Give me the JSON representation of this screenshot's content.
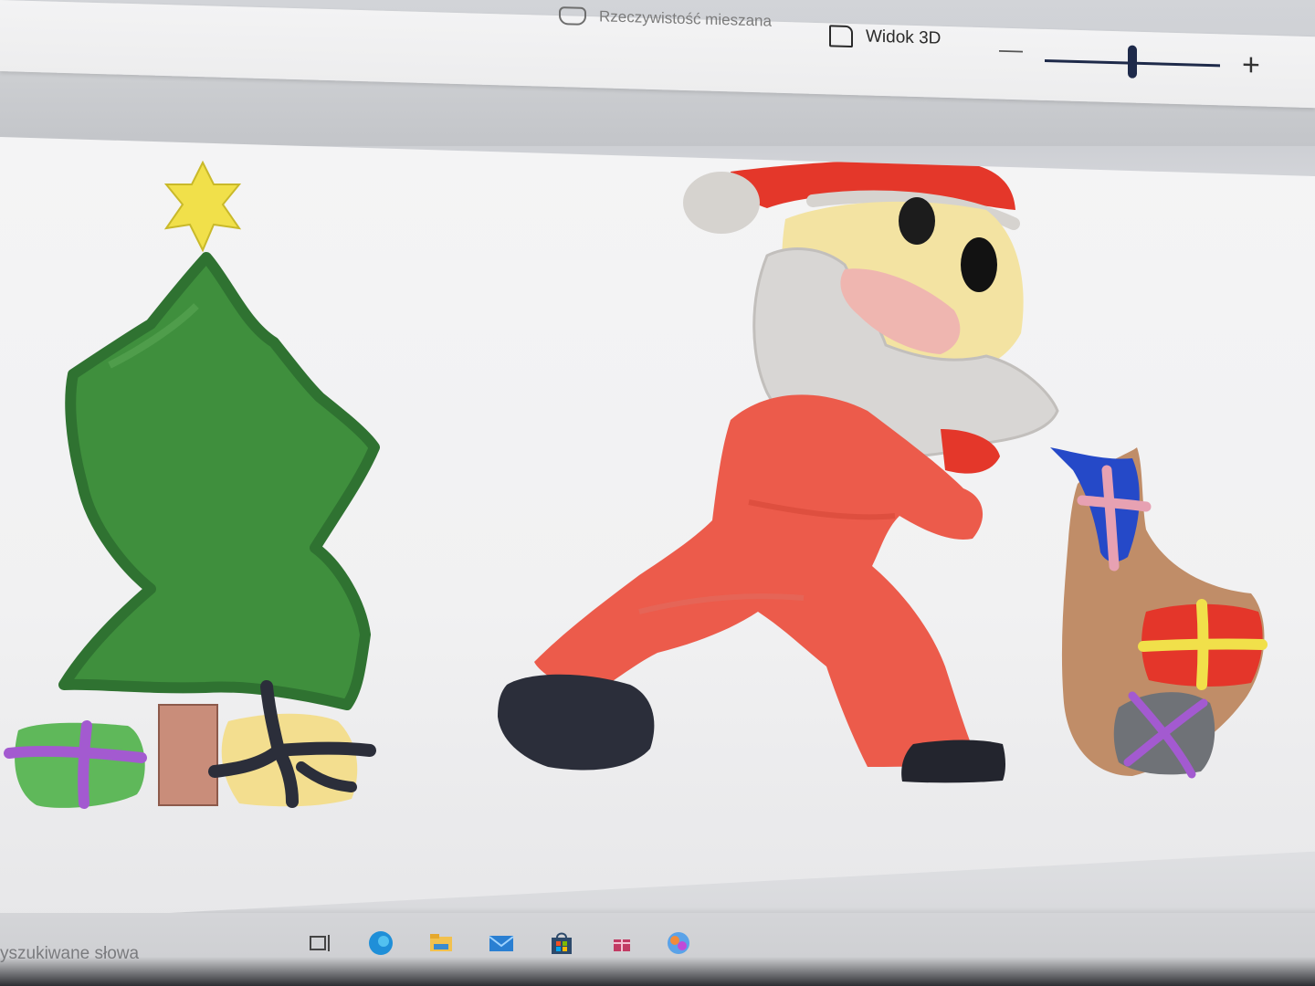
{
  "toolbar": {
    "mixed_reality_label": "Rzeczywistość mieszana",
    "view3d_label": "Widok 3D",
    "zoom_minus": "—",
    "zoom_plus": "+"
  },
  "zoom": {
    "level": 0.5
  },
  "taskbar": {
    "search_placeholder": "yszukiwane słowa",
    "icons": [
      "task-view-icon",
      "edge-icon",
      "file-explorer-icon",
      "mail-icon",
      "store-icon",
      "gift-icon",
      "paint3d-icon"
    ]
  },
  "colors": {
    "tree_green": "#3f8f3d",
    "santa_red": "#ec5b4b",
    "beard_gray": "#d8d6d4",
    "face_yellow": "#f3e3a2",
    "boot_black": "#2b2e3a",
    "sack_brown": "#c08d68",
    "star_yellow": "#f1e04a",
    "ribbon_purple": "#a35ad0",
    "ribbon_blue": "#2549c8",
    "ribbon_pink": "#e7a1b2",
    "gift_red": "#e4362a",
    "gift_gray": "#6f7277"
  }
}
